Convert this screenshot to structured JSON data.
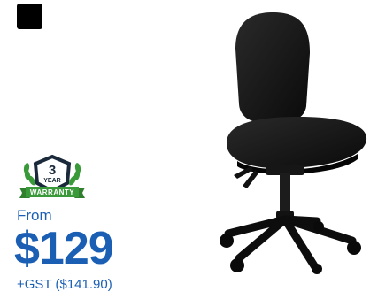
{
  "product": {
    "color_swatch": "#000000",
    "warranty": {
      "number": "3",
      "unit": "YEAR",
      "label": "WARRANTY"
    },
    "price_prefix": "From",
    "price": "$129",
    "price_note": "+GST ($141.90)",
    "accent_color": "#1a5fb4",
    "image_icon": "office-chair-image"
  }
}
